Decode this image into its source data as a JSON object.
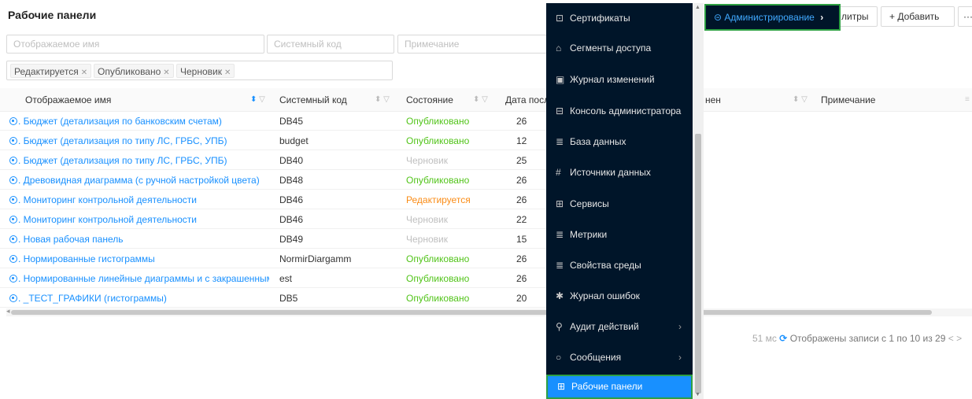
{
  "page": {
    "title": "Рабочие панели"
  },
  "filters": {
    "display_name_placeholder": "Отображаемое имя",
    "system_code_placeholder": "Системный код",
    "note_placeholder": "Примечание",
    "chips": [
      "Редактируется",
      "Опубликовано",
      "Черновик"
    ]
  },
  "toolbar": {
    "admin_label": "Администрирование",
    "filters_label": "литры",
    "add_label": "Добавить",
    "more_label": "···"
  },
  "table": {
    "headers": {
      "name": "Отображаемое имя",
      "code": "Системный код",
      "state": "Состояние",
      "date": "Дата посл",
      "changed": "нен",
      "note": "Примечание"
    },
    "rows": [
      {
        "name": "Бюджет (детализация по банковским счетам)",
        "code": "DB45",
        "state": "Опубликовано",
        "date": "26"
      },
      {
        "name": "Бюджет (детализация по типу ЛС, ГРБС, УПБ)",
        "code": "budget",
        "state": "Опубликовано",
        "date": "12"
      },
      {
        "name": "Бюджет (детализация по типу ЛС, ГРБС, УПБ)",
        "code": "DB40",
        "state": "Черновик",
        "date": "25"
      },
      {
        "name": "Древовидная диаграмма (с ручной настройкой цвета)",
        "code": "DB48",
        "state": "Опубликовано",
        "date": "26"
      },
      {
        "name": "Мониторинг контрольной деятельности",
        "code": "DB46",
        "state": "Редактируется",
        "date": "26"
      },
      {
        "name": "Мониторинг контрольной деятельности",
        "code": "DB46",
        "state": "Черновик",
        "date": "22"
      },
      {
        "name": "Новая рабочая панель",
        "code": "DB49",
        "state": "Черновик",
        "date": "15"
      },
      {
        "name": "Нормированные гистограммы",
        "code": "NormirDiargamm",
        "state": "Опубликовано",
        "date": "26"
      },
      {
        "name": "Нормированные линейные диаграммы и с закрашенными...",
        "code": "est",
        "state": "Опубликовано",
        "date": "26"
      },
      {
        "name": "_ТЕСТ_ГРАФИКИ (гистограммы)",
        "code": "DB5",
        "state": "Опубликовано",
        "date": "20"
      }
    ]
  },
  "footer": {
    "ms": "51 мс",
    "records": "Отображены записи с 1 по 10 из 29",
    "prev": "<",
    "next": ">"
  },
  "menu": {
    "items": [
      {
        "label": "Сертификаты",
        "icon": "certificate-icon",
        "glyph": "⊡"
      },
      {
        "label": "Сегменты доступа",
        "icon": "lock-icon",
        "glyph": "⌂"
      },
      {
        "label": "Журнал изменений",
        "icon": "calendar-icon",
        "glyph": "▣"
      },
      {
        "label": "Консоль администратора",
        "icon": "console-icon",
        "glyph": "⊟"
      },
      {
        "label": "База данных",
        "icon": "database-icon",
        "glyph": "≣"
      },
      {
        "label": "Источники данных",
        "icon": "hash-icon",
        "glyph": "#"
      },
      {
        "label": "Сервисы",
        "icon": "services-icon",
        "glyph": "⊞"
      },
      {
        "label": "Метрики",
        "icon": "metrics-icon",
        "glyph": "≣"
      },
      {
        "label": "Свойства среды",
        "icon": "properties-icon",
        "glyph": "≣"
      },
      {
        "label": "Журнал ошибок",
        "icon": "bug-icon",
        "glyph": "✱"
      },
      {
        "label": "Аудит действий",
        "icon": "search-icon",
        "glyph": "⚲",
        "has_sub": true
      },
      {
        "label": "Сообщения",
        "icon": "message-icon",
        "glyph": "○",
        "has_sub": true
      },
      {
        "label": "Рабочие панели",
        "icon": "dashboard-icon",
        "glyph": "⊞",
        "active": true
      }
    ]
  },
  "colors": {
    "published": "#52c41a",
    "editing": "#fa8c16",
    "draft": "#bfbfbf",
    "link": "#1890ff",
    "menu_bg": "#001529",
    "highlight_border": "#2ea043"
  }
}
